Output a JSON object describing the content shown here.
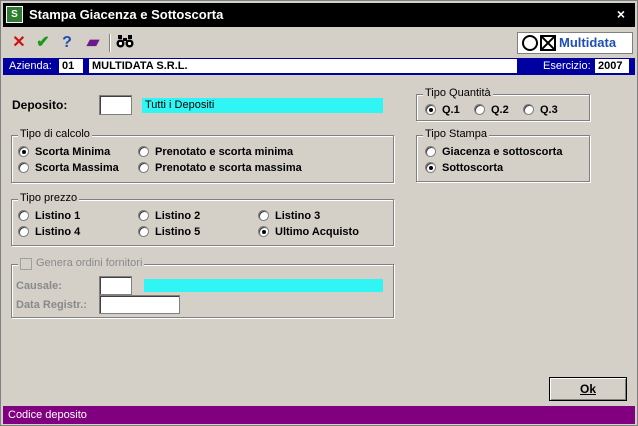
{
  "window": {
    "title": "Stampa Giacenza e Sottoscorta",
    "app_icon": "S",
    "close_glyph": "×"
  },
  "toolbar": {
    "cancel_glyph": "✕",
    "confirm_glyph": "✔",
    "help_glyph": "?",
    "book_glyph": "▰",
    "search_glyph": "⚲",
    "brand": "Multidata"
  },
  "company": {
    "azienda_label": "Azienda:",
    "azienda_code": "01",
    "azienda_name": "MULTIDATA S.R.L.",
    "esercizio_label": "Esercizio:",
    "esercizio_value": "2007"
  },
  "deposito": {
    "label": "Deposito:",
    "code_value": "",
    "description": "Tutti i Depositi"
  },
  "tipo_calcolo": {
    "legend": "Tipo di calcolo",
    "options": [
      {
        "label": "Scorta Minima",
        "selected": true
      },
      {
        "label": "Prenotato e scorta minima",
        "selected": false
      },
      {
        "label": "Scorta Massima",
        "selected": false
      },
      {
        "label": "Prenotato e scorta massima",
        "selected": false
      }
    ]
  },
  "tipo_prezzo": {
    "legend": "Tipo prezzo",
    "options": [
      {
        "label": "Listino 1",
        "selected": false
      },
      {
        "label": "Listino 2",
        "selected": false
      },
      {
        "label": "Listino 3",
        "selected": false
      },
      {
        "label": "Listino 4",
        "selected": false
      },
      {
        "label": "Listino 5",
        "selected": false
      },
      {
        "label": "Ultimo Acquisto",
        "selected": true
      }
    ]
  },
  "genera_ordini": {
    "legend": "Genera ordini fornitori",
    "checked": false,
    "causale_label": "Causale:",
    "data_label": "Data Registr.:"
  },
  "tipo_quantita": {
    "legend": "Tipo Quantità",
    "options": [
      {
        "label": "Q.1",
        "selected": true
      },
      {
        "label": "Q.2",
        "selected": false
      },
      {
        "label": "Q.3",
        "selected": false
      }
    ]
  },
  "tipo_stampa": {
    "legend": "Tipo Stampa",
    "options": [
      {
        "label": "Giacenza e sottoscorta",
        "selected": false
      },
      {
        "label": "Sottoscorta",
        "selected": true
      }
    ]
  },
  "ok_button": {
    "label": "Ok"
  },
  "status": {
    "text": "Codice deposito"
  },
  "colors": {
    "title_bg": "#000000",
    "company_bar": "#0000a0",
    "status_bar": "#800080",
    "field_cyan": "#2ff5f5",
    "brand_blue": "#1e4fb4"
  }
}
